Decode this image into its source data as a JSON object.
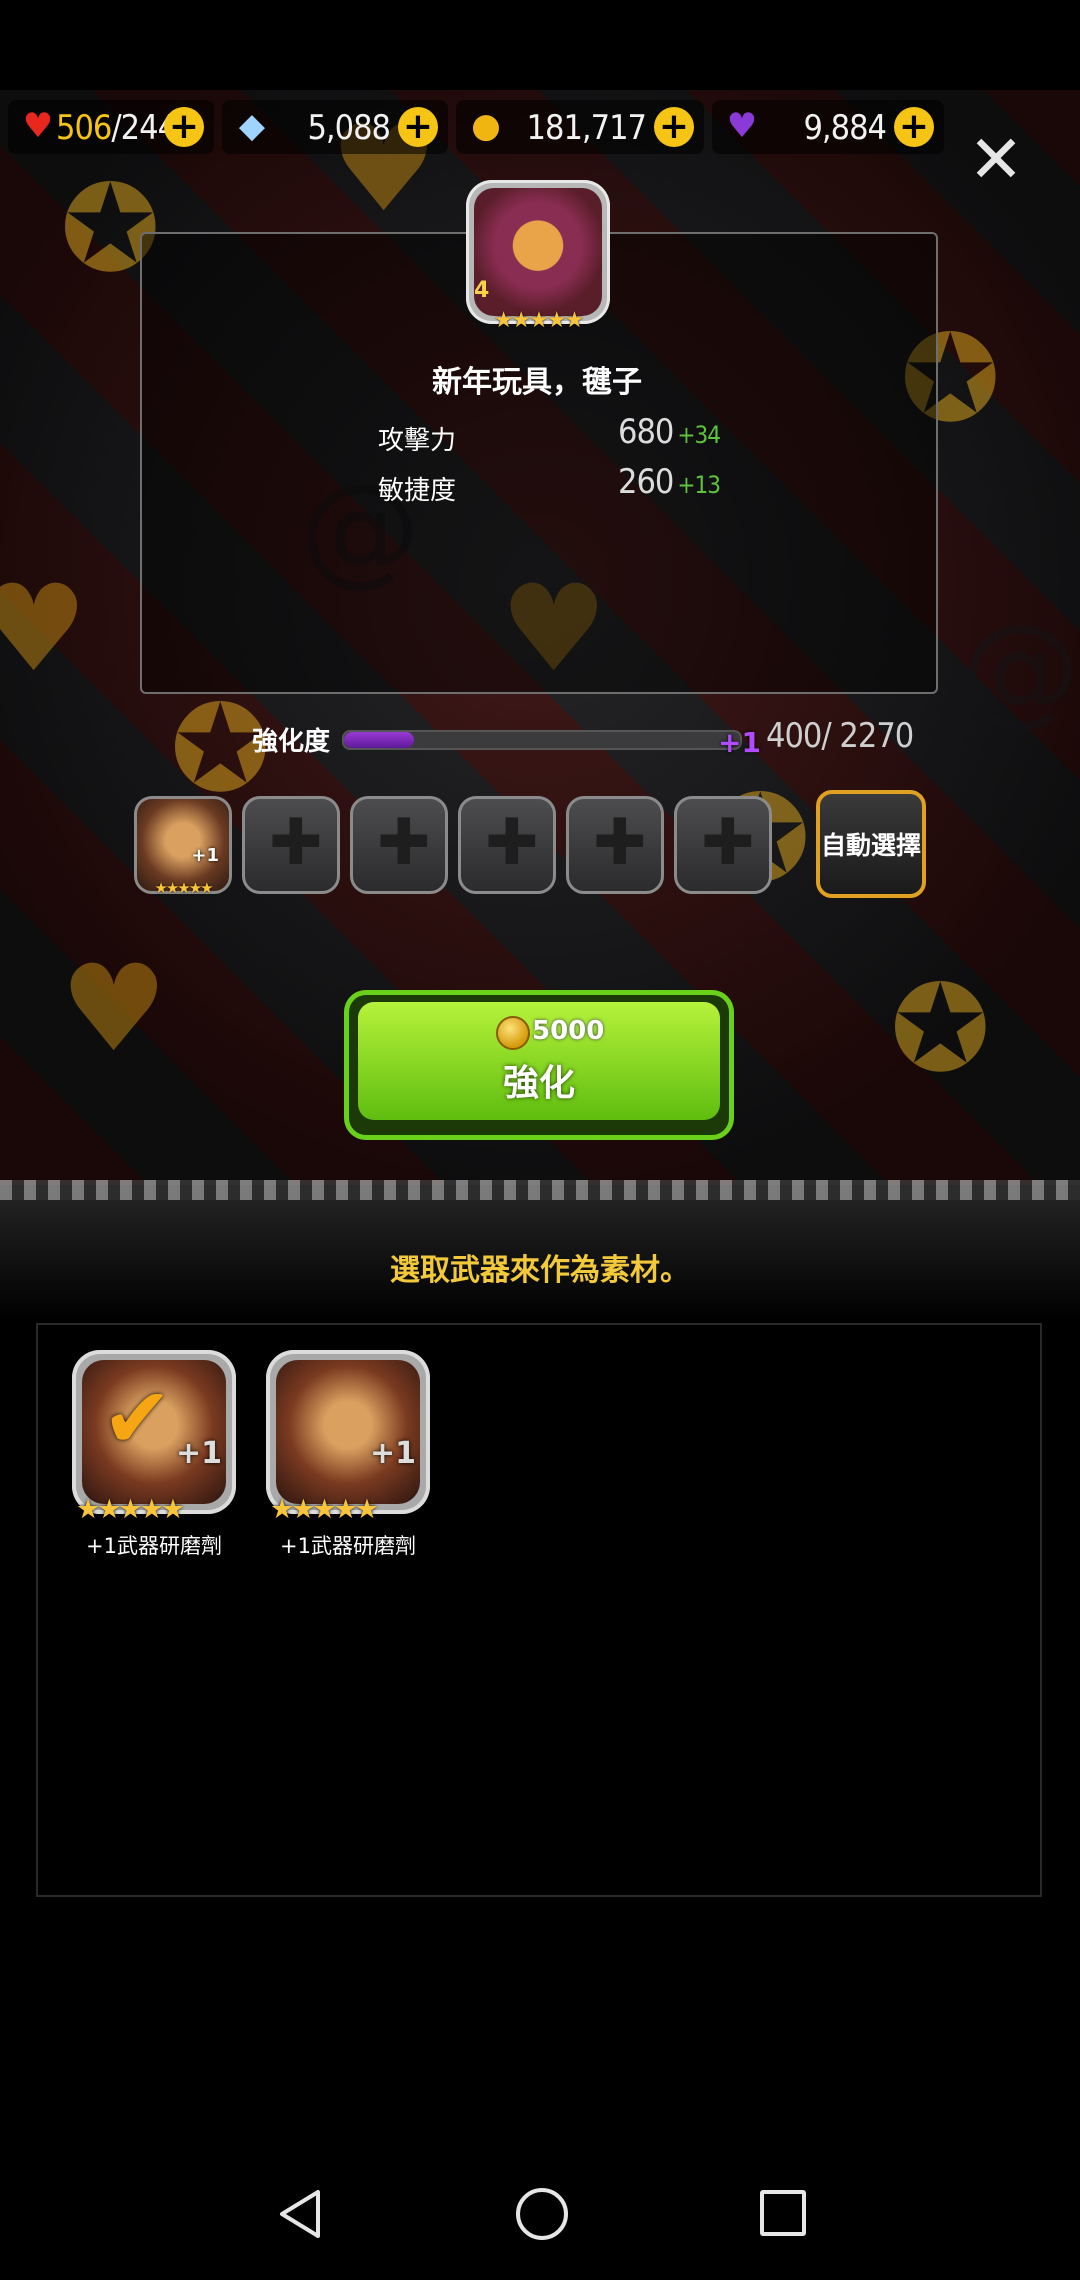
{
  "resources": {
    "stamina": {
      "current": "506",
      "max": "/244",
      "icon": "heart-icon"
    },
    "crystals": {
      "value": "5,088",
      "icon": "rainbow-crystal-icon"
    },
    "gold": {
      "value": "181,717",
      "icon": "gold-coin-icon"
    },
    "gems": {
      "value": "9,884",
      "icon": "purple-gem-icon"
    },
    "plus_symbol": "+"
  },
  "item": {
    "name": "新年玩具，毽子",
    "level_badge": "4",
    "stars": "★★★★★",
    "stats": [
      {
        "label": "攻擊力",
        "value": "680",
        "increase": "+34"
      },
      {
        "label": "敏捷度",
        "value": "260",
        "increase": "+13"
      }
    ]
  },
  "enhancement": {
    "label": "強化度",
    "progress_fraction": 0.176,
    "level_gain": "+1",
    "current": "400",
    "required": "2270"
  },
  "slots": {
    "filled_item": {
      "stars": "★★★★★",
      "badge": "+1"
    },
    "empty_count": 5,
    "auto_select_label": "自動選擇"
  },
  "enhance_button": {
    "cost": "5000",
    "label": "強化"
  },
  "hint": "選取武器來作為素材。",
  "materials": [
    {
      "name": "+1武器研磨劑",
      "stars": "★★★★★",
      "badge": "+1",
      "selected": true
    },
    {
      "name": "+1武器研磨劑",
      "stars": "★★★★★",
      "badge": "+1",
      "selected": false
    }
  ],
  "colors": {
    "accent_gold": "#f6c414",
    "stat_increase": "#5cc33a",
    "enhance_green": "#7fd21a",
    "progress_purple": "#9a3ad6",
    "hint_text": "#f2c93a"
  }
}
